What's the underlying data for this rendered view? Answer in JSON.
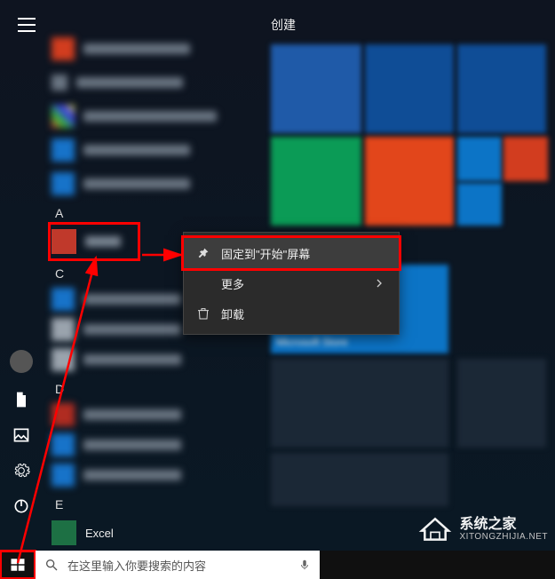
{
  "tile_header": "创建",
  "alpha": {
    "a": "A",
    "c": "C",
    "d": "D",
    "e": "E"
  },
  "apps": {
    "e_item": "Excel"
  },
  "tiles": {
    "store_label": "Microsoft Store"
  },
  "context_menu": {
    "pin": "固定到\"开始\"屏幕",
    "more": "更多",
    "uninstall": "卸载"
  },
  "search": {
    "placeholder": "在这里输入你要搜索的内容"
  },
  "watermark": {
    "title": "系统之家",
    "url": "XITONGZHIJIA.NET"
  }
}
